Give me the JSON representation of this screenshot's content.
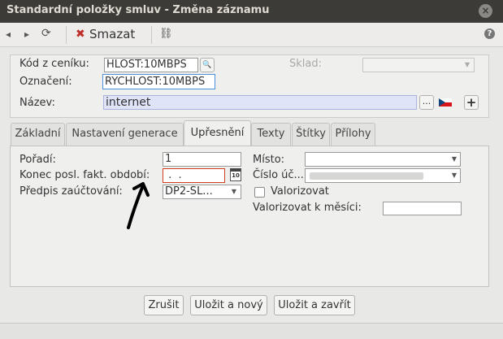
{
  "window": {
    "title": "Standardní položky smluv - Změna záznamu",
    "close_glyph": "×"
  },
  "toolbar": {
    "back_glyph": "◂",
    "forward_glyph": "▸",
    "refresh_glyph": "⟳",
    "delete_glyph": "✖",
    "delete_label": "Smazat",
    "link_glyph": "⛓",
    "help_glyph": "?"
  },
  "header": {
    "kod_label": "Kód z ceníku:",
    "kod_value": "HLOST:10MBPS",
    "search_glyph": "🔍",
    "sklad_label": "Sklad:",
    "oznaceni_label": "Označení:",
    "oznaceni_value": "RYCHLOST:10MBPS",
    "nazev_label": "Název:",
    "nazev_value": "internet",
    "ellipsis_label": "...",
    "plus_glyph": "+"
  },
  "tabs": [
    {
      "label": "Základní"
    },
    {
      "label": "Nastavení generace"
    },
    {
      "label": "Upřesnění"
    },
    {
      "label": "Texty"
    },
    {
      "label": "Štítky"
    },
    {
      "label": "Přílohy"
    }
  ],
  "form": {
    "poradi_label": "Pořadí:",
    "poradi_value": "1",
    "konec_label": "Konec posl. fakt. období:",
    "konec_value": " .  .",
    "calendar_glyph": "10",
    "predpis_label": "Předpis zaúčtování:",
    "predpis_value": "DP2-SL...",
    "misto_label": "Místo:",
    "cislo_label": "Číslo úč...",
    "valorizovat_label": "Valorizovat",
    "valorizovat_checked": false,
    "valorizovat_k_label": "Valorizovat k měsíci:"
  },
  "footer": {
    "zrusit_label": "Zrušit",
    "ulozit_novy_label": "Uložit a nový",
    "ulozit_zavrit_label": "Uložit a zavřít"
  },
  "colors": {
    "titlebar": "#3c3b37",
    "accent_blue": "#4a90d9",
    "error_red": "#d04020",
    "delete_red": "#c0302a"
  }
}
